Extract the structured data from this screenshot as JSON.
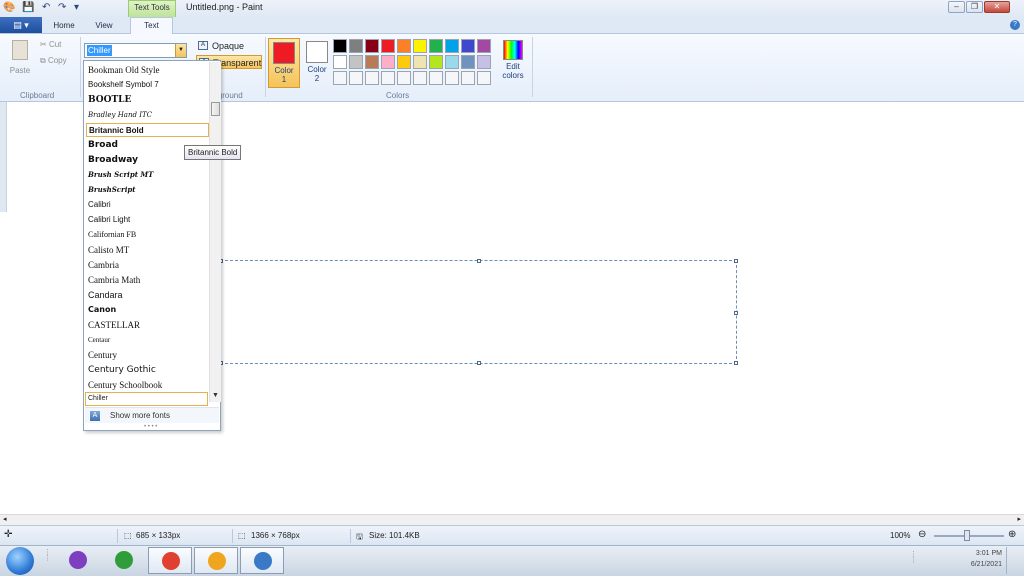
{
  "window": {
    "title": "Untitled.png - Paint",
    "context_tab": "Text Tools",
    "controls": [
      "minimize-icon",
      "restore-icon",
      "close-icon"
    ]
  },
  "tabs": [
    {
      "label": "Home"
    },
    {
      "label": "View"
    },
    {
      "label": "Text",
      "active": true
    }
  ],
  "ribbon": {
    "clipboard": {
      "paste_label": "Paste",
      "cut_label": "Cut",
      "copy_label": "Copy",
      "group_label": "Clipboard"
    },
    "font": {
      "current": "Chiller"
    },
    "background": {
      "opaque_label": "Opaque",
      "transparent_label": "Transparent",
      "group_label": "Background",
      "selected": "Transparent"
    },
    "colors": {
      "color1_label": "Color",
      "color1_num": "1",
      "color2_label": "Color",
      "color2_num": "2",
      "color1_value": "#ed1c24",
      "color2_value": "#ffffff",
      "edit_label": "Edit",
      "edit_label2": "colors",
      "group_label": "Colors",
      "palette_row1": [
        "#000000",
        "#7f7f7f",
        "#880015",
        "#ed1c24",
        "#ff7f27",
        "#fff200",
        "#22b14c",
        "#00a2e8",
        "#3f48cc",
        "#a349a4"
      ],
      "palette_row2": [
        "#ffffff",
        "#c3c3c3",
        "#b97a57",
        "#ffaec9",
        "#ffc90e",
        "#efe4b0",
        "#b5e61d",
        "#99d9ea",
        "#7092be",
        "#c8bfe7"
      ]
    }
  },
  "font_dropdown": {
    "fonts": [
      {
        "name": "Bookman Old Style",
        "font": "\"Liberation Serif\", serif",
        "size": "9px"
      },
      {
        "name": "Bookshelf Symbol 7",
        "font": "\"Liberation Sans\", sans-serif",
        "size": "8px"
      },
      {
        "name": "BOOTLE",
        "font": "\"DejaVu Serif\", serif",
        "size": "9px",
        "weight": "bold"
      },
      {
        "name": "Bradley Hand ITC",
        "font": "\"DejaVu Serif\", serif",
        "size": "7px",
        "style": "italic"
      },
      {
        "name": "Britannic Bold",
        "font": "\"Liberation Sans\", sans-serif",
        "size": "8px",
        "weight": "bold",
        "hover": true
      },
      {
        "name": "Broad",
        "font": "\"DejaVu Sans\", sans-serif",
        "size": "9px",
        "weight": "bold"
      },
      {
        "name": "Broadway",
        "font": "\"DejaVu Sans\", sans-serif",
        "size": "9px",
        "weight": "bold"
      },
      {
        "name": "Brush Script MT",
        "font": "\"DejaVu Serif\", serif",
        "size": "7px",
        "style": "italic",
        "weight": "bold"
      },
      {
        "name": "BrushScript",
        "font": "\"DejaVu Serif\", serif",
        "size": "7px",
        "style": "italic",
        "weight": "bold"
      },
      {
        "name": "Calibri",
        "font": "\"Liberation Sans\", sans-serif",
        "size": "8px"
      },
      {
        "name": "Calibri Light",
        "font": "\"Liberation Sans\", sans-serif",
        "size": "8px"
      },
      {
        "name": "Californian FB",
        "font": "\"Liberation Serif\", serif",
        "size": "8px"
      },
      {
        "name": "Calisto MT",
        "font": "\"Liberation Serif\", serif",
        "size": "9px"
      },
      {
        "name": "Cambria",
        "font": "\"Liberation Serif\", serif",
        "size": "9px"
      },
      {
        "name": "Cambria Math",
        "font": "\"Liberation Serif\", serif",
        "size": "9px"
      },
      {
        "name": "Candara",
        "font": "\"Liberation Sans\", sans-serif",
        "size": "9px"
      },
      {
        "name": "Canon",
        "font": "\"DejaVu Sans\", sans-serif",
        "size": "8px",
        "weight": "bold"
      },
      {
        "name": "CASTELLAR",
        "font": "\"Liberation Serif\", serif",
        "size": "9px"
      },
      {
        "name": "Centaur",
        "font": "\"Liberation Serif\", serif",
        "size": "7px"
      },
      {
        "name": "Century",
        "font": "\"Liberation Serif\", serif",
        "size": "9px"
      },
      {
        "name": "Century Gothic",
        "font": "\"DejaVu Sans\", sans-serif",
        "size": "9px"
      },
      {
        "name": "Century Schoolbook",
        "font": "\"Liberation Serif\", serif",
        "size": "9px"
      }
    ],
    "selected": "Chiller",
    "more_fonts_label": "Show more fonts"
  },
  "tooltip": "Britannic Bold",
  "status": {
    "selection_size": "685 × 133px",
    "image_size": "1366 × 768px",
    "file_size": "Size: 101.4KB",
    "zoom": "100%"
  },
  "taskbar": {
    "apps": [
      {
        "name": "visual-studio-icon",
        "color": "#7d3fbf"
      },
      {
        "name": "app-icon",
        "color": "#2e9d3a"
      },
      {
        "name": "chrome-icon",
        "color": "#e0402f"
      },
      {
        "name": "picasa-icon",
        "color": "#f0a51f"
      },
      {
        "name": "paint-icon",
        "color": "#3a79c7"
      }
    ],
    "clock_time": "3:01 PM",
    "clock_date": "6/21/2021"
  }
}
